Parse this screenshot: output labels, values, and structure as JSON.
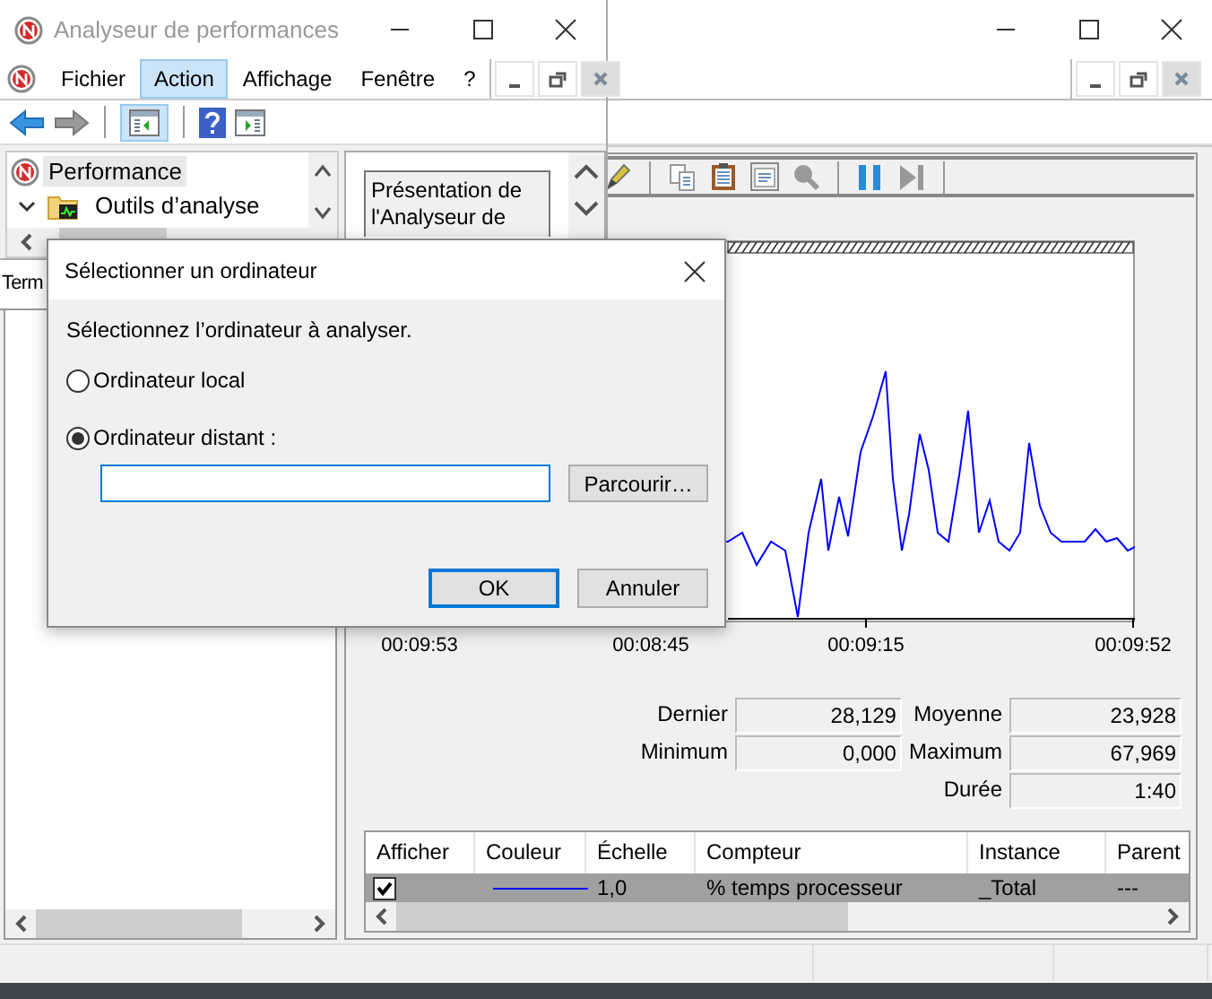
{
  "back_window": {
    "graph": {
      "x_labels": [
        "00:09:53",
        "00:08:45",
        "00:09:15",
        "00:09:52"
      ]
    },
    "stats": [
      {
        "left": {
          "label": "Dernier",
          "value": "28,129"
        },
        "right": {
          "label": "Moyenne",
          "value": "23,928"
        }
      },
      {
        "left": {
          "label": "Minimum",
          "value": "0,000"
        },
        "right": {
          "label": "Maximum",
          "value": "67,969"
        }
      },
      {
        "right": {
          "label": "Durée",
          "value": "1:40"
        }
      }
    ],
    "legend": {
      "columns": [
        "Afficher",
        "Couleur",
        "Échelle",
        "Compteur",
        "Instance",
        "Parent"
      ],
      "rows": [
        {
          "checked": true,
          "selected": true,
          "color": "#0000ff",
          "scale": "1,0",
          "counter": "% temps processeur",
          "instance": "_Total",
          "parent": "---"
        }
      ]
    }
  },
  "front_window": {
    "title": "Analyseur de performances",
    "menu": [
      {
        "label": "Fichier",
        "selected": false
      },
      {
        "label": "Action",
        "selected": true
      },
      {
        "label": "Affichage",
        "selected": false
      },
      {
        "label": "Fenêtre",
        "selected": false
      },
      {
        "label": "?",
        "selected": false
      }
    ],
    "tree": [
      {
        "label": "Performance",
        "selected": true,
        "children": [
          {
            "label": "Outils d’analyse",
            "selected": false,
            "expanded": true
          }
        ]
      }
    ],
    "panel_button": "Présentation de l'Analyseur de",
    "bottom_text": "Term"
  },
  "dialog": {
    "title": "Sélectionner un ordinateur",
    "prompt": "Sélectionnez l’ordinateur à analyser.",
    "options": [
      {
        "label": "Ordinateur local",
        "selected": false
      },
      {
        "label": "Ordinateur distant :",
        "selected": true
      }
    ],
    "computer_field": {
      "focused": true
    },
    "browse_button": "Parcourir…",
    "buttons": [
      {
        "label": "OK",
        "default": true
      },
      {
        "label": "Annuler",
        "default": false
      }
    ]
  }
}
